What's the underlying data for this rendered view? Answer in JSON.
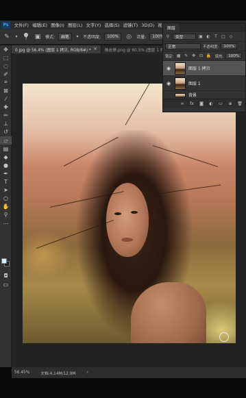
{
  "app": {
    "logo": "Ps"
  },
  "menu": [
    "文件(F)",
    "编辑(E)",
    "图像(I)",
    "图层(L)",
    "文字(Y)",
    "选择(S)",
    "滤镜(T)",
    "3D(D)",
    "视图(V)"
  ],
  "options_bar": {
    "brush_size": "7",
    "mode_label": "模式:",
    "mode_value": "画笔",
    "opacity_label": "不透明度:",
    "opacity_value": "100%",
    "flow_label": "流量:",
    "flow_value": "100%"
  },
  "tabs": [
    {
      "label": "0.jpg @ 56.4% (图层 1 拷贝, RGB/8#) *",
      "close": "×",
      "active": true
    },
    {
      "label": "橡皮擦.png @ 60.5% (图层 1 拷贝",
      "close": "×",
      "active": false
    }
  ],
  "status": {
    "zoom": "56.45%",
    "doc": "文档:4.14M/12.9M"
  },
  "layers_panel": {
    "tab": "图层",
    "filter_kind": "类型",
    "blend_mode": "正常",
    "opacity_label": "不透明度:",
    "opacity_value": "100%",
    "lock_label": "锁定:",
    "fill_label": "填充:",
    "fill_value": "100%",
    "layers": [
      {
        "name": "图层 1 拷贝",
        "selected": true
      },
      {
        "name": "图层 1",
        "selected": false
      }
    ],
    "partial_layer": "背景"
  },
  "colors": {
    "ui_dark": "#323232",
    "selected_layer": "#545454",
    "foreground_color": "#cfefff",
    "background_color": "#1a1a1a"
  },
  "icons": {
    "tools": [
      "move-icon",
      "marquee-icon",
      "lasso-icon",
      "quick-select-icon",
      "crop-icon",
      "frame-icon",
      "eyedropper-icon",
      "healing-icon",
      "brush-icon",
      "stamp-icon",
      "history-brush-icon",
      "eraser-icon",
      "gradient-icon",
      "blur-icon",
      "dodge-icon",
      "pen-icon",
      "type-icon",
      "path-select-icon",
      "shape-icon",
      "hand-icon",
      "zoom-icon",
      "more-tools-icon"
    ]
  }
}
